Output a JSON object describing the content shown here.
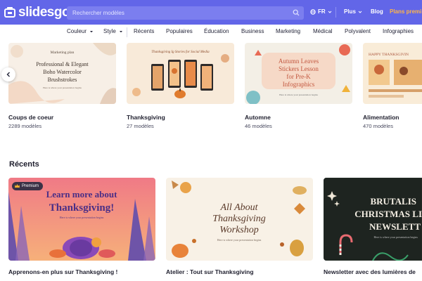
{
  "header": {
    "logo_text": "slidesgo",
    "search_placeholder": "Rechercher modèles",
    "language": "FR",
    "more_label": "Plus",
    "blog_label": "Blog",
    "plans_label": "Plans premi",
    "brand_color": "#6266e8",
    "plans_color": "#ffb547"
  },
  "nav": {
    "items": [
      {
        "label": "Couleur",
        "dropdown": true
      },
      {
        "label": "Style",
        "dropdown": true
      },
      {
        "label": "Récents"
      },
      {
        "label": "Populaires"
      },
      {
        "label": "Éducation"
      },
      {
        "label": "Business"
      },
      {
        "label": "Marketing"
      },
      {
        "label": "Médical"
      },
      {
        "label": "Polyvalent"
      },
      {
        "label": "Infographies"
      }
    ]
  },
  "categories": [
    {
      "title": "Coups de coeur",
      "count": "2289 modèles",
      "thumb_small": "Marketing plan",
      "thumb_title": "Professional & Elegant Boho Watercolor Brushstrokes",
      "thumb_sub": "Here is where your presentation begins"
    },
    {
      "title": "Thanksgiving",
      "count": "27 modèles",
      "thumb_title": "Thanksgiving Ig Stories for Social Media"
    },
    {
      "title": "Automne",
      "count": "46 modèles",
      "thumb_title": "Autumn Leaves Stickers Lesson for Pre-K Infographics",
      "thumb_sub": "Here is where your presentation begins"
    },
    {
      "title": "Alimentation",
      "count": "470 modèles",
      "thumb_title": "HAPPY THANKSGIVIN"
    }
  ],
  "recents": {
    "title": "Récents",
    "items": [
      {
        "title": "Apprenons-en plus sur Thanksgiving !",
        "badge": "Premium",
        "thumb_title": "Learn more about Thanksgiving!",
        "thumb_sub": "Here is where your presentation begins"
      },
      {
        "title": "Atelier : Tout sur Thanksgiving",
        "thumb_title": "All About Thanksgiving Workshop",
        "thumb_sub": "Here is where your presentation begins"
      },
      {
        "title": "Newsletter avec des lumières de",
        "thumb_title": "BRUTALIS CHRISTMAS LI NEWSLETT",
        "thumb_sub": "Here is where your presentation begins"
      }
    ]
  }
}
